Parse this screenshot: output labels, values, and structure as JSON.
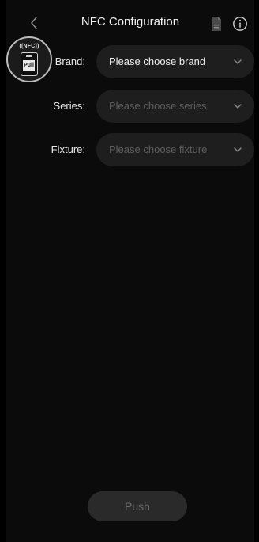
{
  "header": {
    "title": "NFC Configuration",
    "back_icon": "chevron-left-icon",
    "doc_icon": "document-icon",
    "info_icon": "info-icon"
  },
  "nfc_badge": {
    "top_text": "((NFC))",
    "phone_text": "Pull",
    "icon": "nfc-pull-icon"
  },
  "form": {
    "rows": [
      {
        "label": "Brand:",
        "value": "Please choose  brand",
        "state": "active"
      },
      {
        "label": "Series:",
        "value": "Please choose series",
        "state": "placeholder"
      },
      {
        "label": "Fixture:",
        "value": "Please choose fixture",
        "state": "placeholder"
      }
    ]
  },
  "actions": {
    "push_label": "Push",
    "push_enabled": false
  },
  "colors": {
    "background": "#0b0b0b",
    "field_background": "#1e1e1e",
    "text_primary": "#f0f0f0",
    "text_placeholder": "#5d5d5d",
    "button_disabled_bg": "#2a2a2a"
  }
}
